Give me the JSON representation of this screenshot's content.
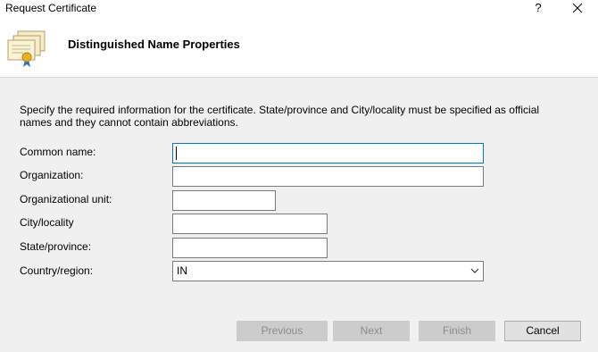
{
  "window": {
    "title": "Request Certificate",
    "help_glyph": "?"
  },
  "header": {
    "heading": "Distinguished Name Properties"
  },
  "description": "Specify the required information for the certificate. State/province and City/locality must be specified as official names and they cannot contain abbreviations.",
  "form": {
    "common_name": {
      "label": "Common name:",
      "value": ""
    },
    "organization": {
      "label": "Organization:",
      "value": ""
    },
    "organizational_unit": {
      "label": "Organizational unit:",
      "value": ""
    },
    "city": {
      "label": "City/locality",
      "value": ""
    },
    "state": {
      "label": "State/province:",
      "value": ""
    },
    "country": {
      "label": "Country/region:",
      "value": "IN"
    }
  },
  "buttons": {
    "previous": "Previous",
    "next": "Next",
    "finish": "Finish",
    "cancel": "Cancel"
  },
  "colors": {
    "focus_border": "#0078d7",
    "disabled_button": "#cccccc",
    "disabled_text": "#8c8c8c"
  }
}
